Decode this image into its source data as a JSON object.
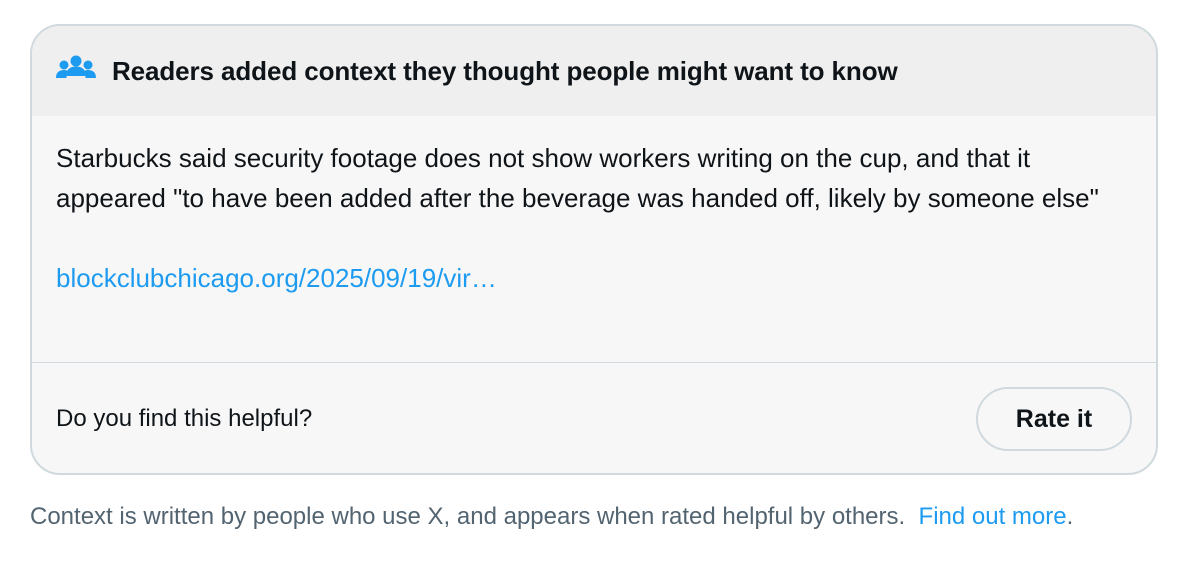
{
  "header": {
    "icon": "people-icon",
    "title": "Readers added context they thought people might want to know"
  },
  "note": {
    "text": "Starbucks said security footage does not show workers writing on the cup, and that it appeared \"to have been added after the beverage was handed off, likely by someone else\"",
    "link": "blockclubchicago.org/2025/09/19/vir…"
  },
  "footer": {
    "question": "Do you find this helpful?",
    "rate_label": "Rate it"
  },
  "footnote": {
    "text": "Context is written by people who use X, and appears when rated helpful by others.",
    "link": "Find out more",
    "period": "."
  },
  "colors": {
    "link": "#1d9bf0",
    "icon": "#1d9bf0",
    "muted": "#536471",
    "border": "#cfd9de"
  }
}
